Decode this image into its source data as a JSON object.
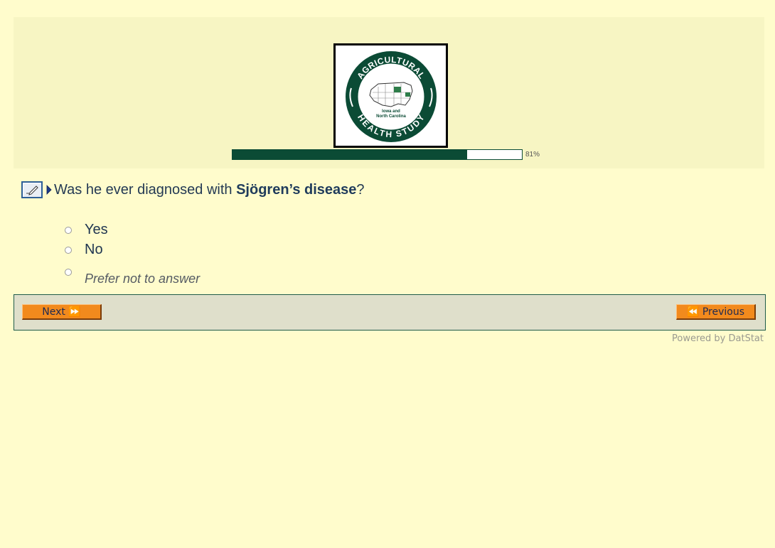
{
  "logo": {
    "top_text": "AGRICULTURAL",
    "bottom_text": "HEALTH STUDY",
    "center_line1": "Iowa and",
    "center_line2": "North Carolina"
  },
  "progress": {
    "value": 0.81,
    "label": "81%"
  },
  "question": {
    "prefix": "Was he ever diagnosed with ",
    "emphasis": "Sjögren’s disease",
    "suffix": "?"
  },
  "options": [
    {
      "label": "Yes"
    },
    {
      "label": "No"
    },
    {
      "label": "Prefer not to answer"
    }
  ],
  "nav": {
    "next_label": "Next ⏩",
    "previous_label": "⏪ Previous"
  },
  "footer": {
    "powered_by": "Powered by DatStat"
  },
  "colors": {
    "brand_green": "#0b4b35",
    "button_orange": "#f28a1d",
    "page_bg": "#fffccc"
  }
}
